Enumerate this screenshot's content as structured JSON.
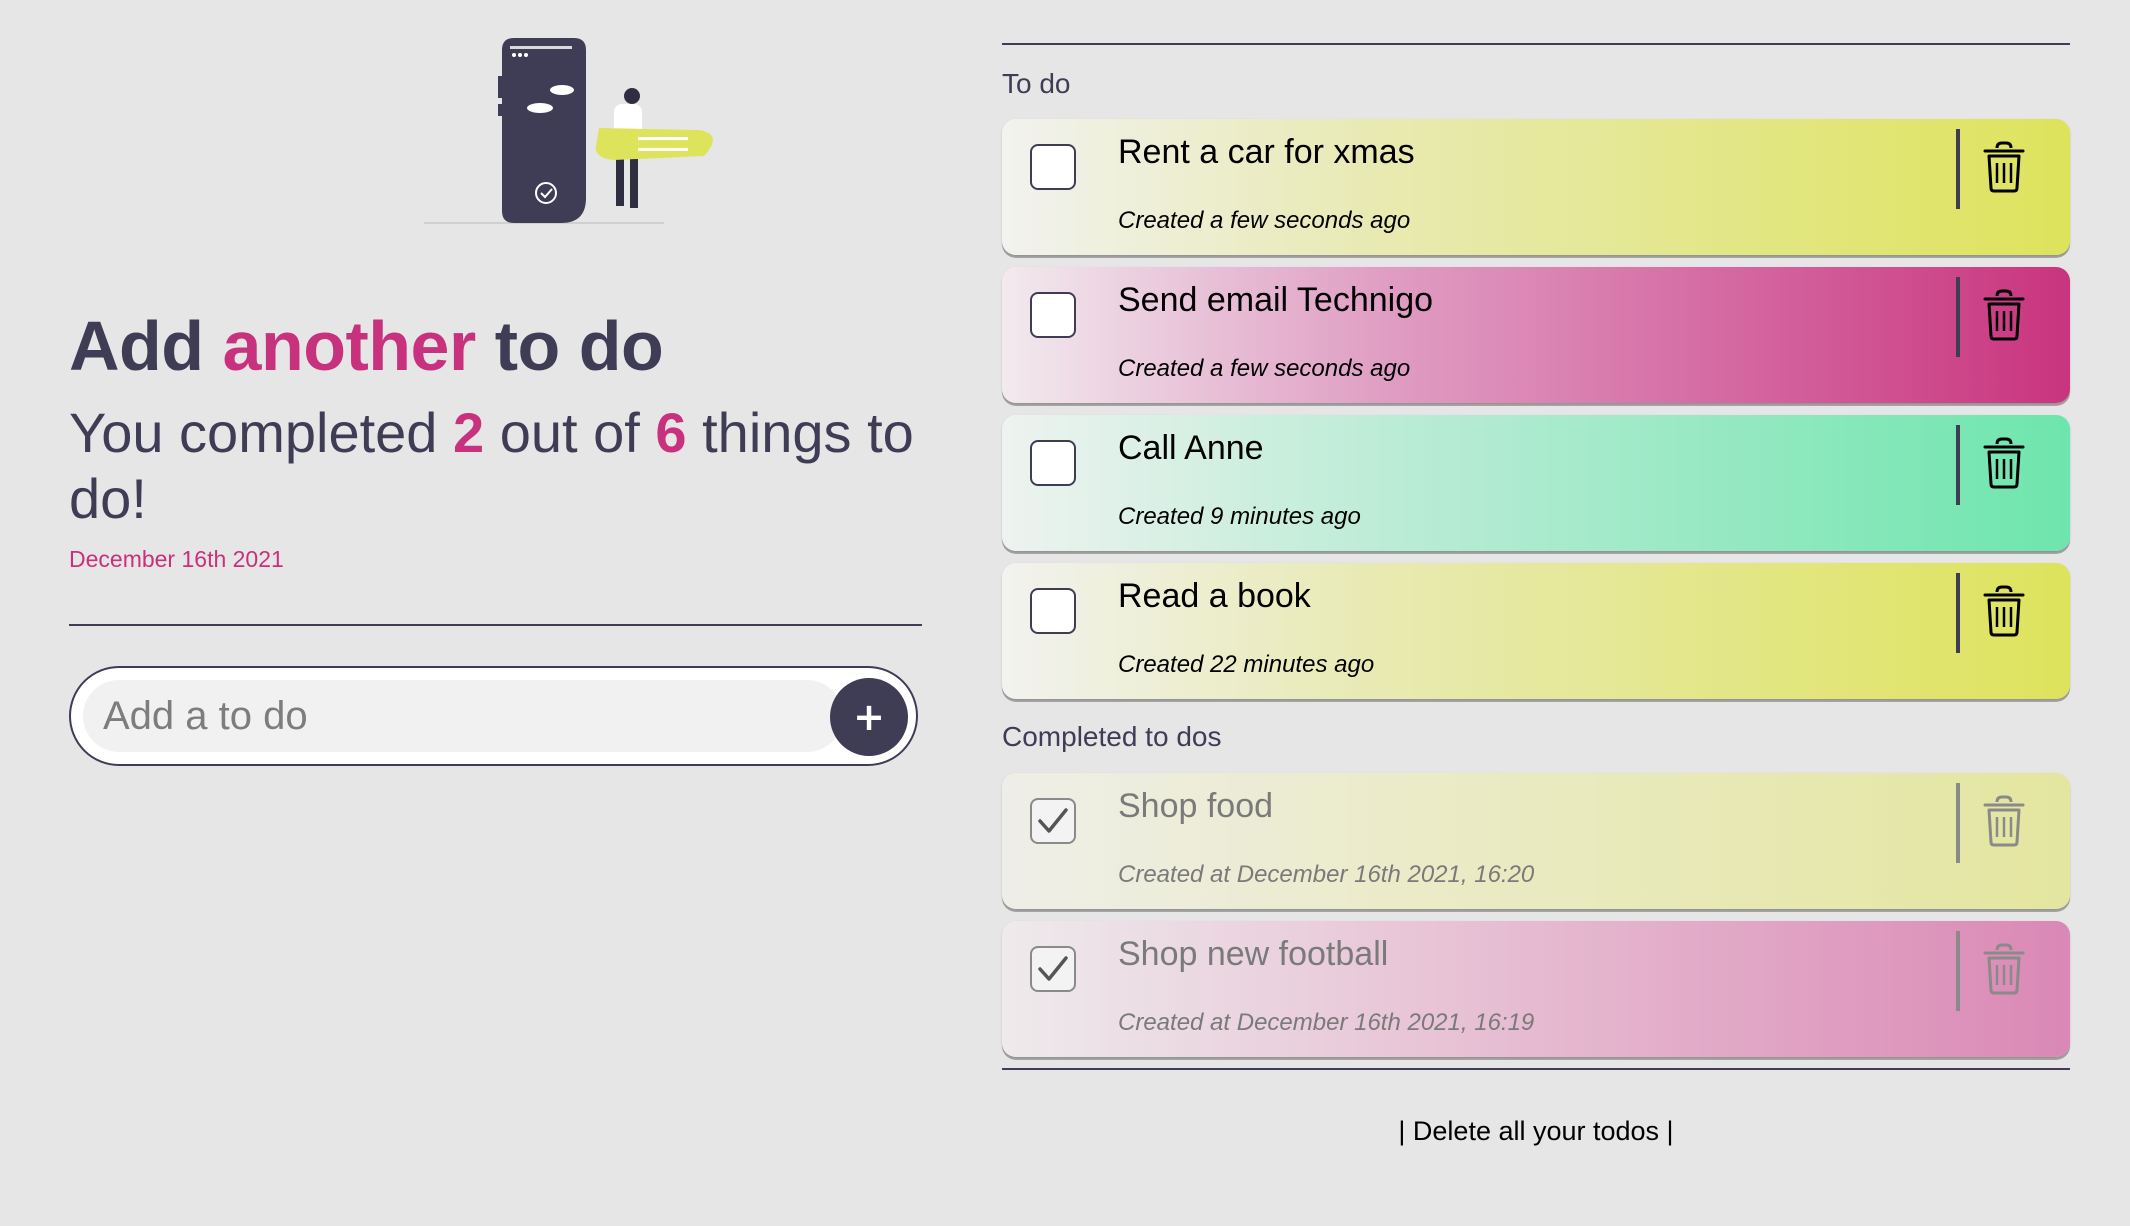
{
  "header": {
    "headline_start": "Add",
    "headline_accent": "another",
    "headline_end": "to do",
    "summary_prefix": "You completed",
    "completed_count": "2",
    "summary_middle": "out of",
    "total_count": "6",
    "summary_suffix": "things to do!",
    "date": "December 16th 2021"
  },
  "add_form": {
    "placeholder": "Add a to do",
    "button_label": "+"
  },
  "todo_section": {
    "title": "To do",
    "items": [
      {
        "title": "Rent a car for xmas",
        "created": "Created a few seconds ago",
        "color": "yellow"
      },
      {
        "title": "Send email Technigo",
        "created": "Created a few seconds ago",
        "color": "pink"
      },
      {
        "title": "Call Anne",
        "created": "Created 9 minutes ago",
        "color": "green"
      },
      {
        "title": "Read a book",
        "created": "Created 22 minutes ago",
        "color": "yellow"
      }
    ]
  },
  "completed_section": {
    "title": "Completed to dos",
    "items": [
      {
        "title": "Shop food",
        "created": "Created at December 16th 2021, 16:20",
        "color": "yellow",
        "checked": true
      },
      {
        "title": "Shop new football",
        "created": "Created at December 16th 2021, 16:19",
        "color": "pink",
        "checked": true
      }
    ]
  },
  "footer": {
    "delete_all_label": "| Delete all your todos |"
  },
  "colors": {
    "primary": "#3f3d56",
    "accent": "#c8317d",
    "background": "#e6e6e7",
    "yellow": "#dee35c",
    "pink": "#c9347f",
    "green": "#6ee5ad"
  },
  "icons": {
    "delete": "trash-icon",
    "check": "checkmark-icon",
    "add": "plus-icon"
  }
}
